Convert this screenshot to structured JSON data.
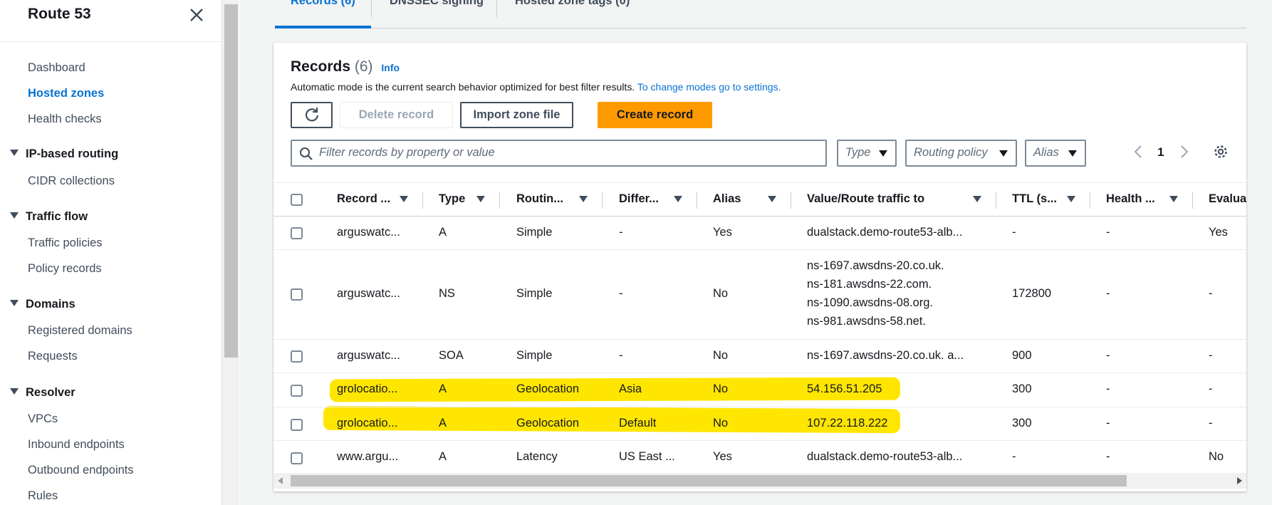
{
  "sidebar": {
    "title": "Route 53",
    "items": {
      "dashboard": "Dashboard",
      "hosted_zones": "Hosted zones",
      "health_checks": "Health checks",
      "cidr_collections": "CIDR collections",
      "traffic_policies": "Traffic policies",
      "policy_records": "Policy records",
      "registered_domains": "Registered domains",
      "requests": "Requests",
      "vpcs": "VPCs",
      "inbound_endpoints": "Inbound endpoints",
      "outbound_endpoints": "Outbound endpoints",
      "rules": "Rules"
    },
    "sections": {
      "ip_routing": "IP-based routing",
      "traffic_flow": "Traffic flow",
      "domains": "Domains",
      "resolver": "Resolver"
    }
  },
  "tabs": [
    "Records (6)",
    "DNSSEC signing",
    "Hosted zone tags (0)"
  ],
  "panel": {
    "title": "Records",
    "count": "(6)",
    "info": "Info",
    "description": "Automatic mode is the current search behavior optimized for best filter results.",
    "description_link": "To change modes go to settings.",
    "buttons": {
      "delete": "Delete record",
      "import": "Import zone file",
      "create": "Create record"
    },
    "filter_placeholder": "Filter records by property or value",
    "dropdowns": {
      "type": "Type",
      "routing": "Routing policy",
      "alias": "Alias"
    },
    "page": "1"
  },
  "table": {
    "columns": [
      "Record ...",
      "Type",
      "Routin...",
      "Differ...",
      "Alias",
      "Value/Route traffic to",
      "TTL (s...",
      "Health ...",
      "Evalua"
    ],
    "rows": [
      {
        "name": "arguswatc...",
        "type": "A",
        "routing": "Simple",
        "diff": "-",
        "alias": "Yes",
        "value": [
          "dualstack.demo-route53-alb..."
        ],
        "ttl": "-",
        "health": "-",
        "eval": "Yes"
      },
      {
        "name": "arguswatc...",
        "type": "NS",
        "routing": "Simple",
        "diff": "-",
        "alias": "No",
        "value": [
          "ns-1697.awsdns-20.co.uk.",
          "ns-181.awsdns-22.com.",
          "ns-1090.awsdns-08.org.",
          "ns-981.awsdns-58.net."
        ],
        "ttl": "172800",
        "health": "-",
        "eval": "-"
      },
      {
        "name": "arguswatc...",
        "type": "SOA",
        "routing": "Simple",
        "diff": "-",
        "alias": "No",
        "value": [
          "ns-1697.awsdns-20.co.uk. a..."
        ],
        "ttl": "900",
        "health": "-",
        "eval": "-"
      },
      {
        "name": "grolocatio...",
        "type": "A",
        "routing": "Geolocation",
        "diff": "Asia",
        "alias": "No",
        "value": [
          "54.156.51.205"
        ],
        "ttl": "300",
        "health": "-",
        "eval": "-"
      },
      {
        "name": "grolocatio...",
        "type": "A",
        "routing": "Geolocation",
        "diff": "Default",
        "alias": "No",
        "value": [
          "107.22.118.222"
        ],
        "ttl": "300",
        "health": "-",
        "eval": "-"
      },
      {
        "name": "www.argu...",
        "type": "A",
        "routing": "Latency",
        "diff": "US East ...",
        "alias": "Yes",
        "value": [
          "dualstack.demo-route53-alb..."
        ],
        "ttl": "-",
        "health": "-",
        "eval": "No"
      }
    ]
  },
  "colors": {
    "accent": "#0972d3",
    "primary_button": "#ff9900",
    "highlight": "#ffe600"
  },
  "icons": [
    "close-icon",
    "refresh-icon",
    "search-icon",
    "settings-gear-icon",
    "chevron-left-icon",
    "chevron-right-icon",
    "caret-down-icon"
  ]
}
